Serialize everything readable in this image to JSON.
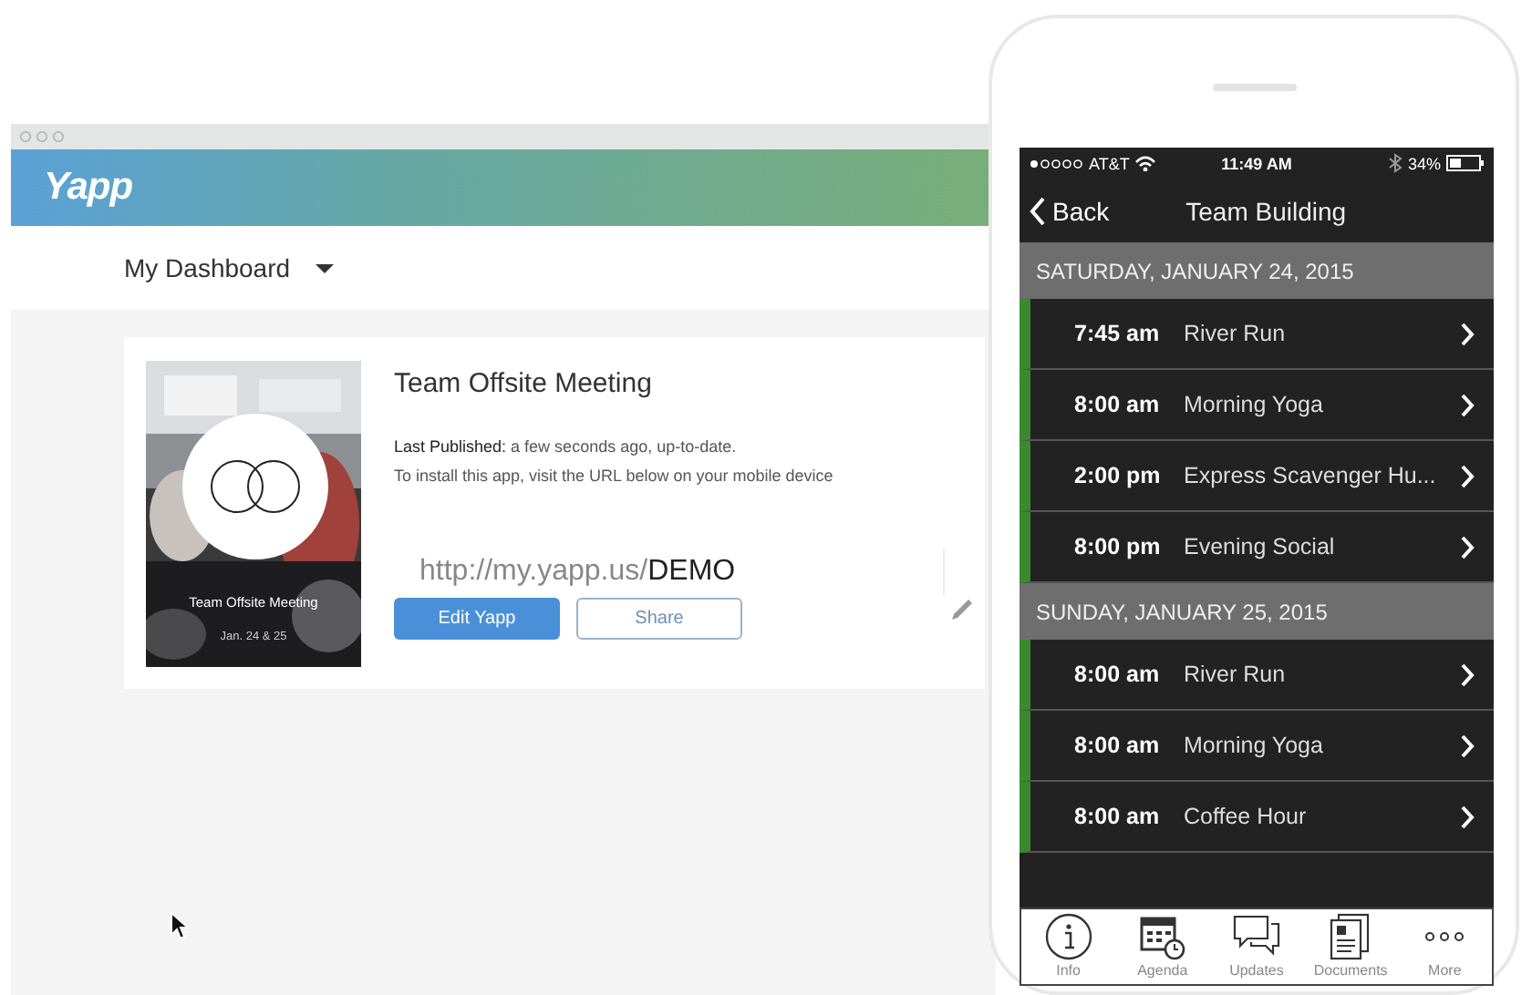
{
  "desktop": {
    "logo": "Yapp",
    "menu": {
      "label": "My Dashboard"
    },
    "card": {
      "cover": {
        "kind": "picture",
        "title": "Team Offsite Meeting",
        "date": "Jan. 24 & 25"
      },
      "title": "Team Offsite Meeting",
      "published": "**Last Published:** a few seconds ago, up-to-date.",
      "install_note": "To install this app, visit the URL below on your mobile device",
      "url": {
        "base": "http://my.yapp.us/",
        "code": "DEMO"
      },
      "buttons": [
        {
          "label": "Edit Yapp",
          "kind": "primary"
        },
        {
          "label": "Share",
          "kind": "secondary"
        }
      ]
    }
  },
  "phone": {
    "status_bar": {
      "carrier": "AT&T",
      "time": "11:49 AM",
      "battery": "34%"
    },
    "nav": {
      "back": "Back",
      "title": "Team Building"
    },
    "days": [
      {
        "heading": "SATURDAY, JANUARY 24, 2015",
        "events": [
          {
            "time": "7:45 am",
            "name": "River Run"
          },
          {
            "time": "8:00 am",
            "name": "Morning Yoga"
          },
          {
            "time": "2:00 pm",
            "name": "Express Scavenger Hu..."
          },
          {
            "time": "8:00 pm",
            "name": "Evening Social"
          }
        ]
      },
      {
        "heading": "SUNDAY, JANUARY 25, 2015",
        "events": [
          {
            "time": "8:00 am",
            "name": "River Run"
          },
          {
            "time": "8:00 am",
            "name": "Morning Yoga"
          },
          {
            "time": "8:00 am",
            "name": "Coffee Hour"
          }
        ]
      }
    ],
    "tab_bar": [
      {
        "label": "Info",
        "kind": "info"
      },
      {
        "label": "Agenda",
        "kind": "agenda"
      },
      {
        "label": "Updates",
        "kind": "updates"
      },
      {
        "label": "Documents",
        "kind": "documents"
      },
      {
        "label": "More",
        "kind": "more"
      }
    ]
  }
}
